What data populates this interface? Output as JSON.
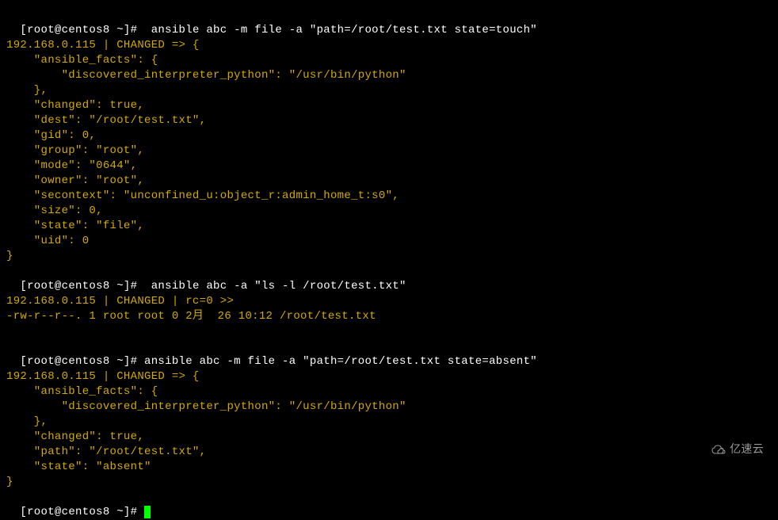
{
  "block1": {
    "prompt": "[root@centos8 ~]#  ",
    "command": "ansible abc -m file -a \"path=/root/test.txt state=touch\"",
    "lines": [
      "192.168.0.115 | CHANGED => {",
      "    \"ansible_facts\": {",
      "        \"discovered_interpreter_python\": \"/usr/bin/python\"",
      "    },",
      "    \"changed\": true,",
      "    \"dest\": \"/root/test.txt\",",
      "    \"gid\": 0,",
      "    \"group\": \"root\",",
      "    \"mode\": \"0644\",",
      "    \"owner\": \"root\",",
      "    \"secontext\": \"unconfined_u:object_r:admin_home_t:s0\",",
      "    \"size\": 0,",
      "    \"state\": \"file\",",
      "    \"uid\": 0",
      "}"
    ]
  },
  "block2": {
    "prompt": "[root@centos8 ~]#  ",
    "command": "ansible abc -a \"ls -l /root/test.txt\"",
    "lines": [
      "192.168.0.115 | CHANGED | rc=0 >>",
      "-rw-r--r--. 1 root root 0 2月  26 10:12 /root/test.txt"
    ]
  },
  "blank": " ",
  "block3": {
    "prompt": "[root@centos8 ~]# ",
    "command": "ansible abc -m file -a \"path=/root/test.txt state=absent\"",
    "lines": [
      "192.168.0.115 | CHANGED => {",
      "    \"ansible_facts\": {",
      "        \"discovered_interpreter_python\": \"/usr/bin/python\"",
      "    },",
      "    \"changed\": true,",
      "    \"path\": \"/root/test.txt\",",
      "    \"state\": \"absent\"",
      "}"
    ]
  },
  "block4": {
    "prompt": "[root@centos8 ~]# "
  },
  "watermark": "亿速云"
}
